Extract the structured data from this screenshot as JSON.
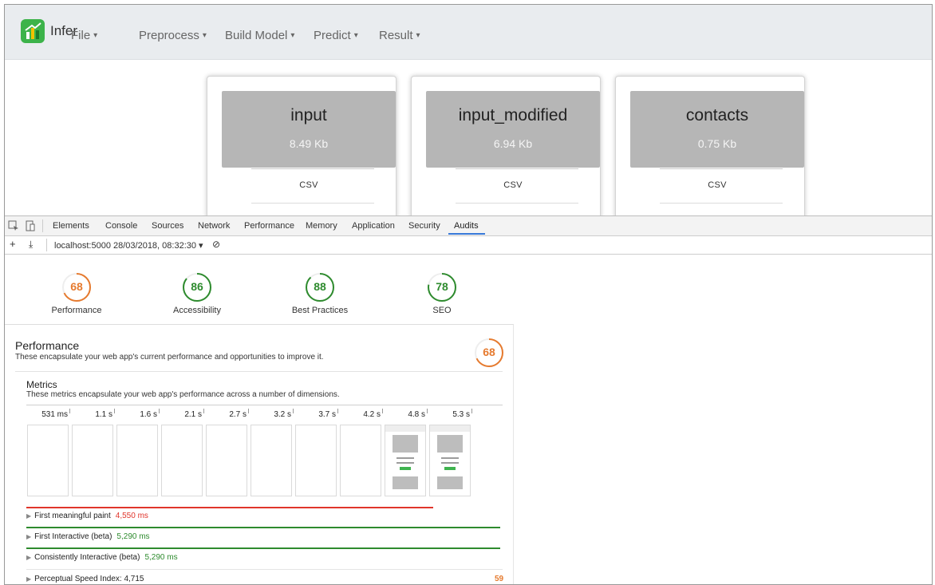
{
  "app": {
    "brand": "Infer",
    "menus": [
      {
        "label": "File"
      },
      {
        "label": "Preprocess"
      },
      {
        "label": "Build Model"
      },
      {
        "label": "Predict"
      },
      {
        "label": "Result"
      }
    ],
    "caret": "▾"
  },
  "datasets": [
    {
      "name": "input",
      "size": "8.49 Kb",
      "type": "CSV"
    },
    {
      "name": "input_modified",
      "size": "6.94 Kb",
      "type": "CSV"
    },
    {
      "name": "contacts",
      "size": "0.75 Kb",
      "type": "CSV"
    }
  ],
  "devtools": {
    "tabs": [
      "Elements",
      "Console",
      "Sources",
      "Network",
      "Performance",
      "Memory",
      "Application",
      "Security",
      "Audits"
    ],
    "active_tab": "Audits",
    "toolbar": {
      "plus": "+",
      "download": "⤓",
      "report_select": "localhost:5000 28/03/2018, 08:32:30 ▾",
      "clear": "⊘"
    },
    "scores": [
      {
        "label": "Performance",
        "value": "68",
        "color": "#e67a2e",
        "fraction": 0.68
      },
      {
        "label": "Accessibility",
        "value": "86",
        "color": "#2e8b2e",
        "fraction": 0.86
      },
      {
        "label": "Best Practices",
        "value": "88",
        "color": "#2e8b2e",
        "fraction": 0.88
      },
      {
        "label": "SEO",
        "value": "78",
        "color": "#2e8b2e",
        "fraction": 0.78
      }
    ],
    "performance": {
      "title": "Performance",
      "description": "These encapsulate your web app's current performance and opportunities to improve it.",
      "score": "68",
      "metrics_title": "Metrics",
      "metrics_description": "These metrics encapsulate your web app's performance across a number of dimensions.",
      "timeline": [
        "531 ms",
        "1.1 s",
        "1.6 s",
        "2.1 s",
        "2.7 s",
        "3.2 s",
        "3.7 s",
        "4.2 s",
        "4.8 s",
        "5.3 s"
      ],
      "metrics": [
        {
          "label": "First meaningful paint",
          "value": "4,550 ms",
          "status": "red",
          "bar_fraction": 0.855
        },
        {
          "label": "First Interactive (beta)",
          "value": "5,290 ms",
          "status": "green",
          "bar_fraction": 0.995
        },
        {
          "label": "Consistently Interactive (beta)",
          "value": "5,290 ms",
          "status": "green",
          "bar_fraction": 0.995
        },
        {
          "label": "Perceptual Speed Index: 4,715",
          "value": "",
          "status": "none",
          "score": "59"
        }
      ]
    }
  }
}
